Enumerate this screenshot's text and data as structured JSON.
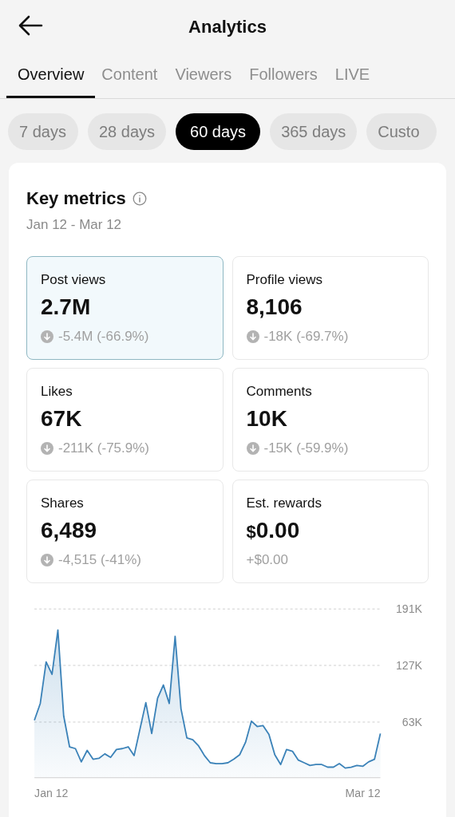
{
  "header": {
    "title": "Analytics"
  },
  "tabs": [
    {
      "label": "Overview",
      "selected": true
    },
    {
      "label": "Content",
      "selected": false
    },
    {
      "label": "Viewers",
      "selected": false
    },
    {
      "label": "Followers",
      "selected": false
    },
    {
      "label": "LIVE",
      "selected": false
    }
  ],
  "ranges": [
    {
      "label": "7 days",
      "selected": false
    },
    {
      "label": "28 days",
      "selected": false
    },
    {
      "label": "60 days",
      "selected": true
    },
    {
      "label": "365 days",
      "selected": false
    },
    {
      "label": "Custo",
      "selected": false
    }
  ],
  "key_metrics": {
    "title": "Key metrics",
    "date_range": "Jan 12 - Mar 12",
    "metrics": [
      {
        "label": "Post views",
        "value": "2.7M",
        "change": "-5.4M (-66.9%)",
        "kind": "down",
        "selected": true
      },
      {
        "label": "Profile views",
        "value": "8,106",
        "change": "-18K (-69.7%)",
        "kind": "down",
        "selected": false
      },
      {
        "label": "Likes",
        "value": "67K",
        "change": "-211K (-75.9%)",
        "kind": "down",
        "selected": false
      },
      {
        "label": "Comments",
        "value": "10K",
        "change": "-15K (-59.9%)",
        "kind": "down",
        "selected": false
      },
      {
        "label": "Shares",
        "value": "6,489",
        "change": "-4,515 (-41%)",
        "kind": "down",
        "selected": false
      },
      {
        "label": "Est. rewards",
        "currency": "$",
        "value": "0.00",
        "change": "+$0.00",
        "kind": "plain",
        "selected": false
      }
    ],
    "chart_data": {
      "type": "area",
      "ylim": [
        0,
        191
      ],
      "yticks": [
        {
          "value": 63,
          "label": "63K"
        },
        {
          "value": 127,
          "label": "127K"
        },
        {
          "value": 191,
          "label": "191K"
        }
      ],
      "series": [
        {
          "color": "#3b82b8",
          "values": [
            65,
            84,
            131,
            117,
            167,
            70,
            35,
            33,
            18,
            31,
            21,
            22,
            27,
            23,
            32,
            33,
            35,
            25,
            55,
            85,
            50,
            90,
            105,
            84,
            160,
            78,
            45,
            43,
            36,
            25,
            17,
            16,
            16,
            17,
            21,
            26,
            40,
            64,
            58,
            59,
            49,
            26,
            15,
            32,
            30,
            20,
            17,
            14,
            15,
            15,
            12,
            12,
            16,
            11,
            12,
            14,
            13,
            18,
            21,
            50
          ]
        }
      ]
    },
    "x_axis_labels": [
      "Jan 12",
      "Mar 12"
    ]
  }
}
